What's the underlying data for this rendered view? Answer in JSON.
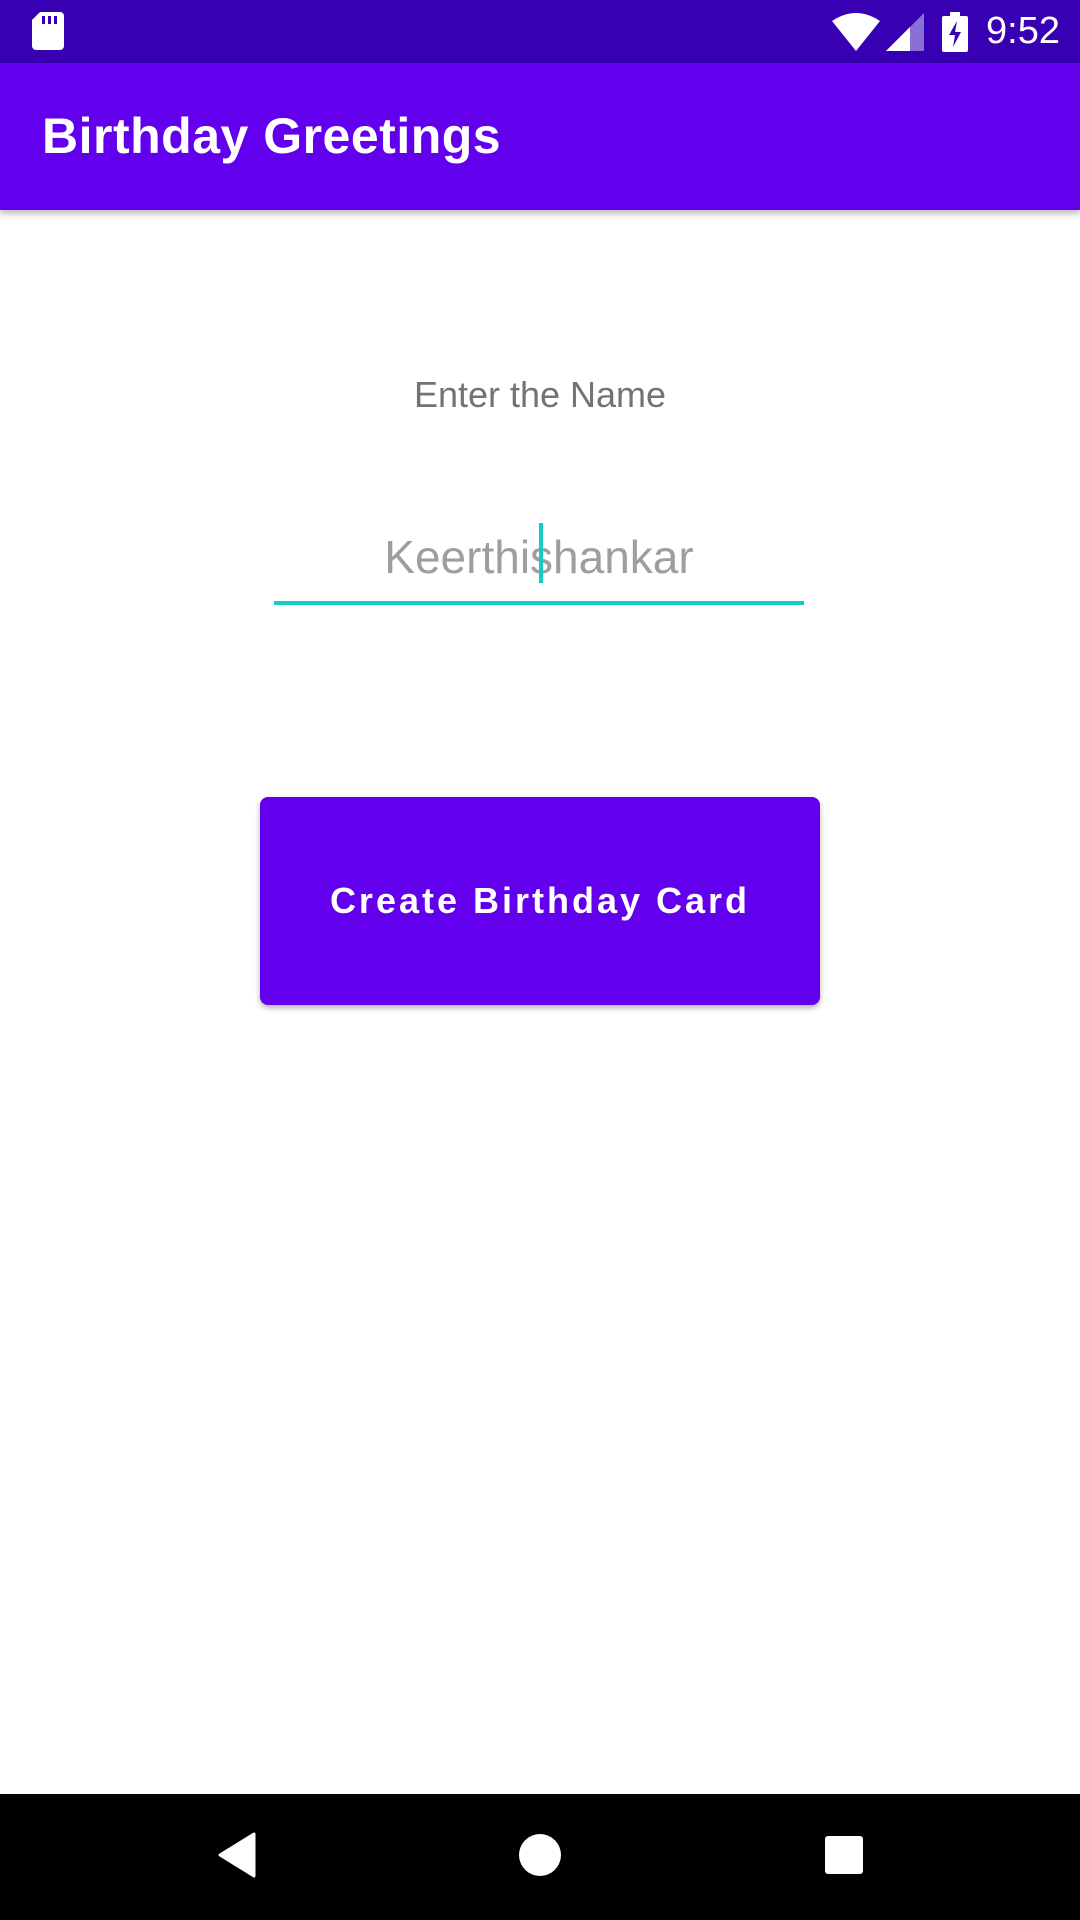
{
  "status_bar": {
    "time": "9:52",
    "left_icon": "sd-card-icon",
    "right_icons": [
      "wifi-icon",
      "signal-icon",
      "battery-charging-icon"
    ],
    "background_color": "#3700B3"
  },
  "app_bar": {
    "title": "Birthday Greetings",
    "background_color": "#6200EE"
  },
  "form": {
    "label": "Enter the Name",
    "name_input": {
      "value": "Keerthishankar",
      "accent_color": "#13CCC3"
    },
    "create_button_label": "Create Birthday Card",
    "button_color": "#6200EE"
  },
  "nav_bar": {
    "buttons": [
      "back-icon",
      "home-icon",
      "recents-icon"
    ]
  }
}
